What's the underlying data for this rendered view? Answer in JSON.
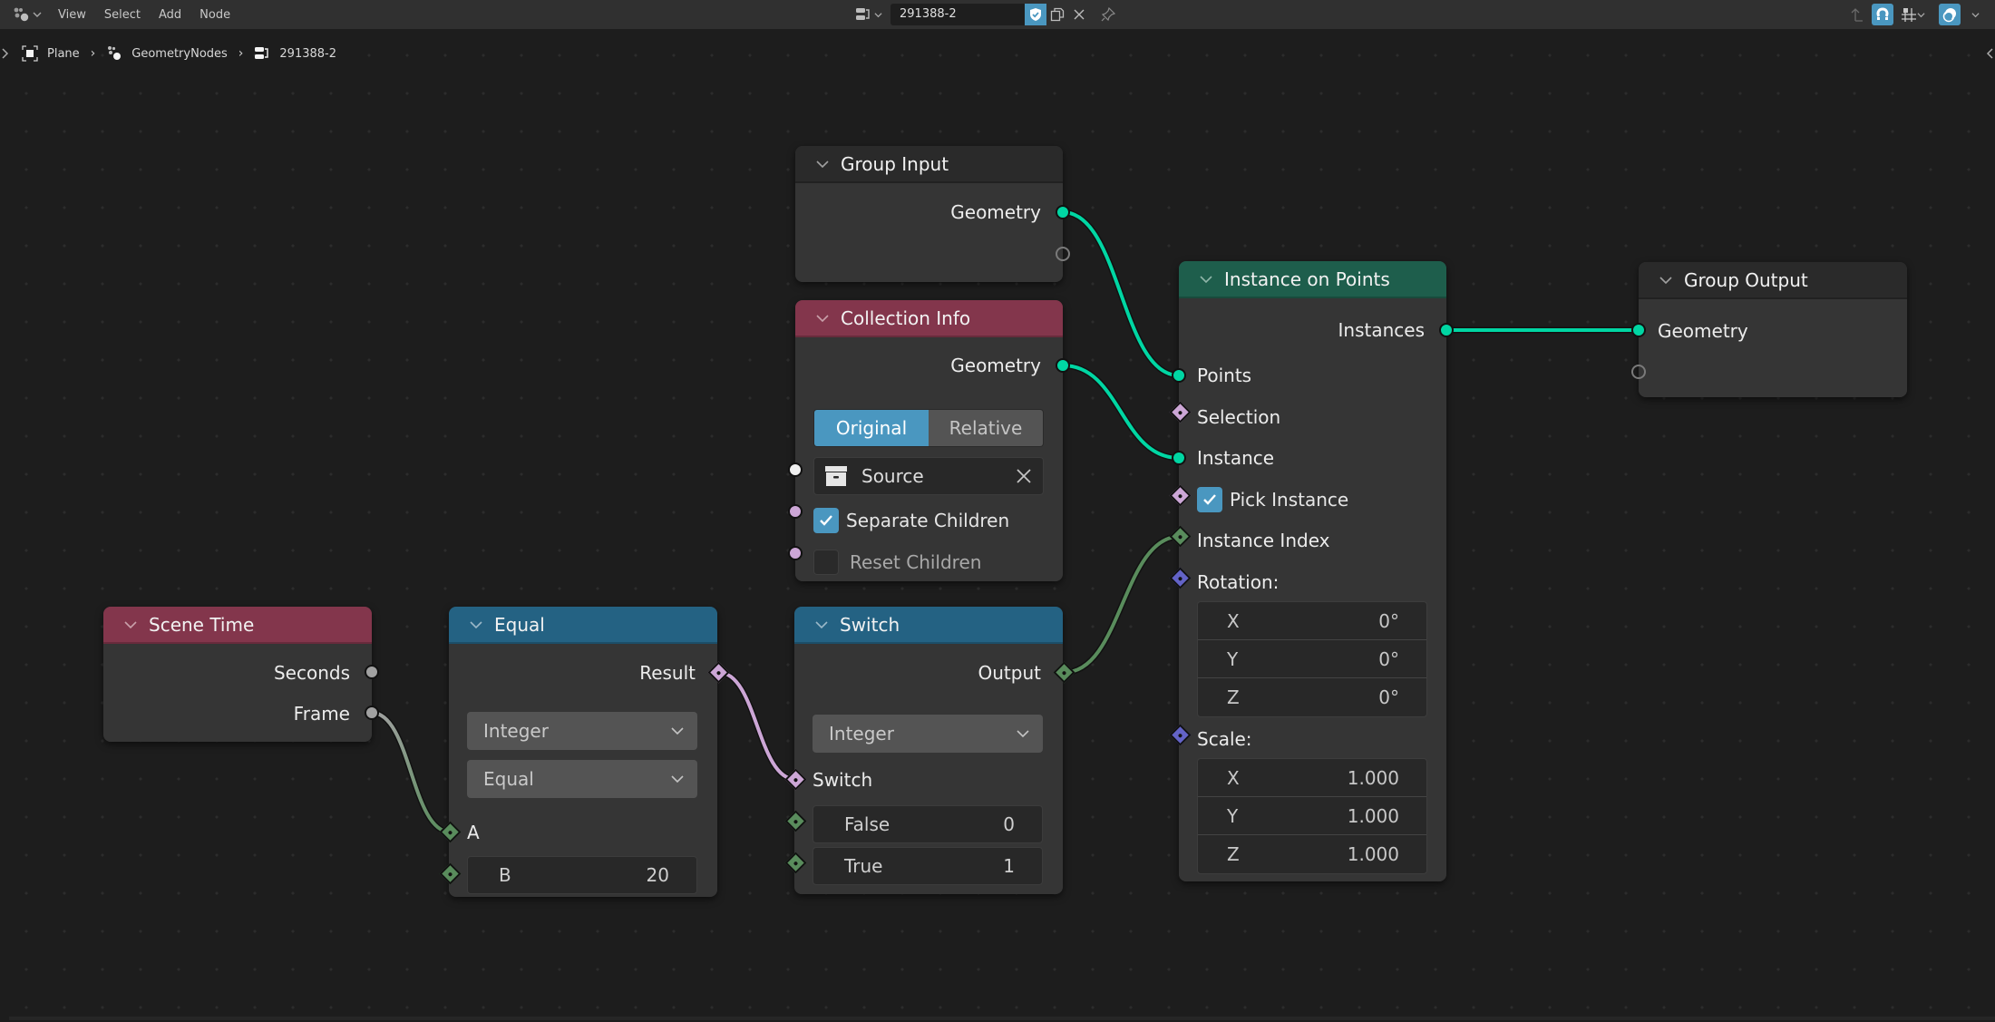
{
  "header": {
    "editor_type_icon": "node-editor-icon",
    "menus": [
      "View",
      "Select",
      "Add",
      "Node"
    ],
    "node_tree_name": "291388-2",
    "fake_user_active": true,
    "right_icons": [
      "parent-arrow-icon",
      "snap-magnet-icon",
      "snap-grid-icon",
      "overlay-icon"
    ]
  },
  "breadcrumb": [
    {
      "icon": "object-icon",
      "label": "Plane"
    },
    {
      "icon": "geometry-nodes-modifier-icon",
      "label": "GeometryNodes"
    },
    {
      "icon": "node-tree-icon",
      "label": "291388-2"
    }
  ],
  "colors": {
    "geometry": "#00d6a3",
    "boolean": "#cca6d6",
    "integer": "#598c5c",
    "vector": "#6363c7",
    "float": "#a1a1a1",
    "accent": "#4a97c0",
    "header_input": "#83364c",
    "header_utility": "#246283",
    "header_geometry": "#1e5e4c"
  },
  "nodes": {
    "group_input": {
      "title": "Group Input",
      "outputs": [
        "Geometry"
      ]
    },
    "collection_info": {
      "title": "Collection Info",
      "outputs": [
        "Geometry"
      ],
      "transform_space": {
        "options": [
          "Original",
          "Relative"
        ],
        "selected": "Original"
      },
      "collection": "Source",
      "separate_children_label": "Separate Children",
      "separate_children": true,
      "reset_children_label": "Reset Children",
      "reset_children": false
    },
    "instance_on_points": {
      "title": "Instance on Points",
      "outputs": [
        "Instances"
      ],
      "inputs": {
        "points": "Points",
        "selection": "Selection",
        "instance": "Instance",
        "pick_instance_label": "Pick Instance",
        "pick_instance": true,
        "instance_index": "Instance Index",
        "rotation_label": "Rotation:",
        "rotation": [
          {
            "axis": "X",
            "value": "0°"
          },
          {
            "axis": "Y",
            "value": "0°"
          },
          {
            "axis": "Z",
            "value": "0°"
          }
        ],
        "scale_label": "Scale:",
        "scale": [
          {
            "axis": "X",
            "value": "1.000"
          },
          {
            "axis": "Y",
            "value": "1.000"
          },
          {
            "axis": "Z",
            "value": "1.000"
          }
        ]
      }
    },
    "group_output": {
      "title": "Group Output",
      "inputs": [
        "Geometry"
      ]
    },
    "scene_time": {
      "title": "Scene Time",
      "outputs": [
        "Seconds",
        "Frame"
      ]
    },
    "equal": {
      "title": "Equal",
      "outputs": [
        "Result"
      ],
      "data_type": "Integer",
      "operation": "Equal",
      "input_a": "A",
      "input_b_label": "B",
      "input_b_value": "20"
    },
    "switch": {
      "title": "Switch",
      "outputs": [
        "Output"
      ],
      "data_type": "Integer",
      "switch_label": "Switch",
      "false_label": "False",
      "false_value": "0",
      "true_label": "True",
      "true_value": "1"
    }
  },
  "links": [
    {
      "from": "Group Input.Geometry",
      "to": "Instance on Points.Points"
    },
    {
      "from": "Collection Info.Geometry",
      "to": "Instance on Points.Instance"
    },
    {
      "from": "Instance on Points.Instances",
      "to": "Group Output.Geometry"
    },
    {
      "from": "Scene Time.Frame",
      "to": "Equal.A"
    },
    {
      "from": "Equal.Result",
      "to": "Switch.Switch"
    },
    {
      "from": "Switch.Output",
      "to": "Instance on Points.Instance Index"
    }
  ]
}
